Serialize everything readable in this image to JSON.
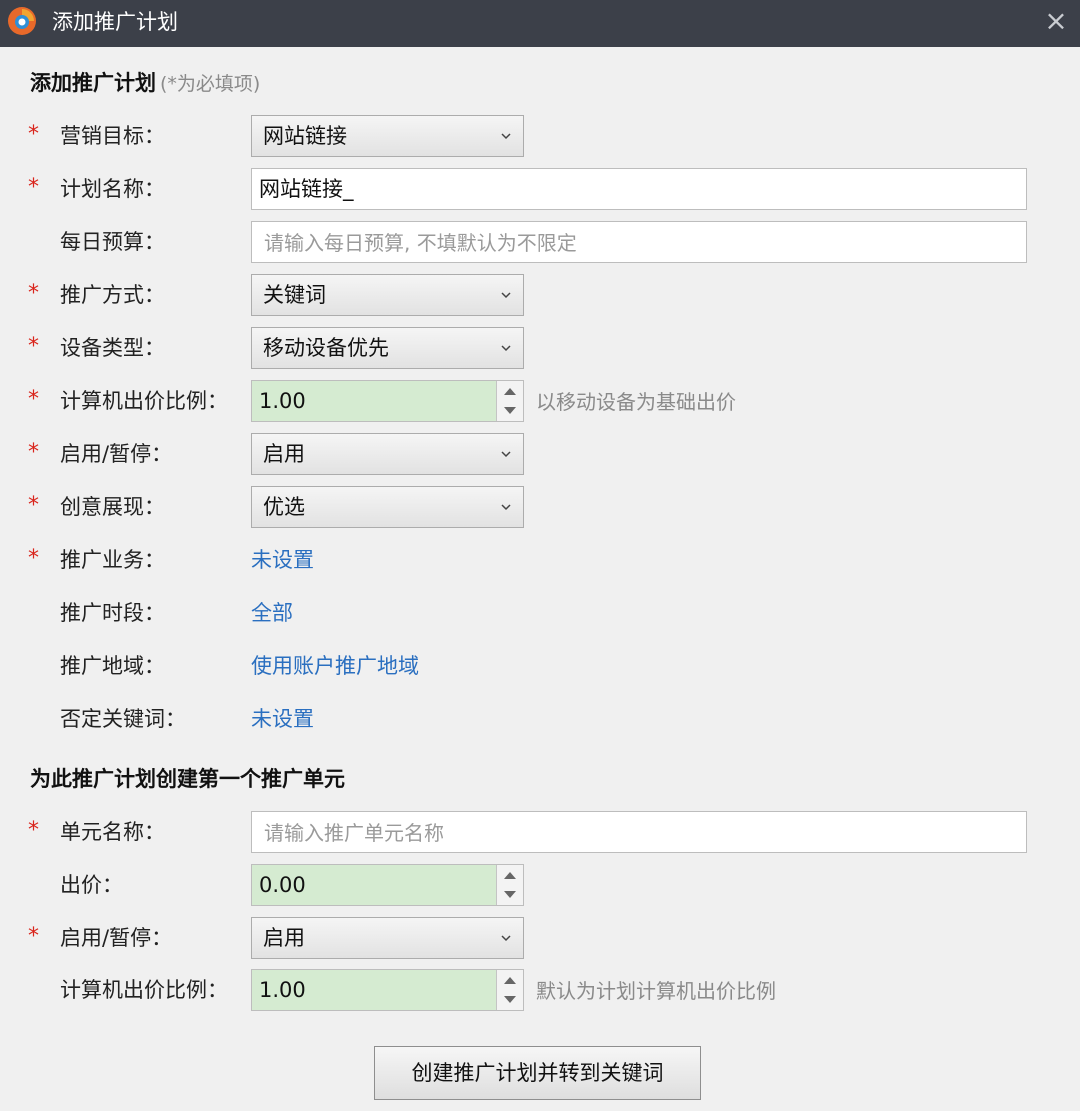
{
  "window": {
    "title": "添加推广计划",
    "close_icon": "×"
  },
  "plan_section": {
    "heading": "添加推广计划",
    "hint": "(*为必填项)",
    "fields": [
      {
        "label": "营销目标：",
        "required": true,
        "type": "select",
        "value": "网站链接"
      },
      {
        "label": "计划名称：",
        "required": true,
        "type": "text",
        "value": "网站链接_"
      },
      {
        "label": "每日预算：",
        "required": false,
        "type": "text",
        "placeholder": "请输入每日预算, 不填默认为不限定"
      },
      {
        "label": "推广方式：",
        "required": true,
        "type": "select",
        "value": "关键词"
      },
      {
        "label": "设备类型：",
        "required": true,
        "type": "select",
        "value": "移动设备优先"
      },
      {
        "label": "计算机出价比例：",
        "required": true,
        "type": "spin",
        "value": "1.00",
        "note": "以移动设备为基础出价"
      },
      {
        "label": "启用/暂停：",
        "required": true,
        "type": "select",
        "value": "启用"
      },
      {
        "label": "创意展现：",
        "required": true,
        "type": "select",
        "value": "优选"
      },
      {
        "label": "推广业务：",
        "required": true,
        "type": "link",
        "value": "未设置"
      },
      {
        "label": "推广时段：",
        "required": false,
        "type": "link",
        "value": "全部"
      },
      {
        "label": "推广地域：",
        "required": false,
        "type": "link",
        "value": "使用账户推广地域"
      },
      {
        "label": "否定关键词：",
        "required": false,
        "type": "link",
        "value": "未设置"
      }
    ]
  },
  "unit_section": {
    "heading": "为此推广计划创建第一个推广单元",
    "fields": [
      {
        "label": "单元名称：",
        "required": true,
        "type": "text",
        "placeholder": "请输入推广单元名称"
      },
      {
        "label": "出价：",
        "required": false,
        "type": "spin",
        "value": "0.00"
      },
      {
        "label": "启用/暂停：",
        "required": true,
        "type": "select",
        "value": "启用"
      },
      {
        "label": "计算机出价比例：",
        "required": false,
        "type": "spin",
        "value": "1.00",
        "note": "默认为计划计算机出价比例"
      }
    ]
  },
  "submit_label": "创建推广计划并转到关键词",
  "required_mark": "*",
  "colors": {
    "titlebar": "#3c4049",
    "required": "#d9251c",
    "link": "#2a6fc0",
    "spin_bg": "#d5ebd1",
    "dialog_bg": "#f0f0f0"
  }
}
